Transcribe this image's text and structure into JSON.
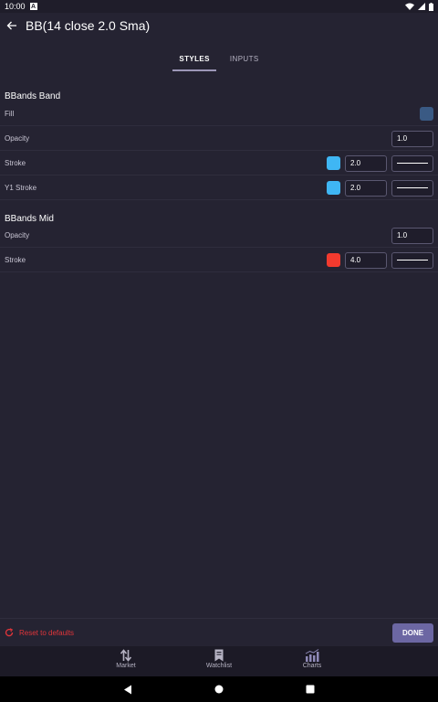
{
  "status_bar": {
    "time": "10:00",
    "notification_icon": "A"
  },
  "header": {
    "title": "BB(14 close 2.0 Sma)"
  },
  "tabs": [
    {
      "label": "STYLES",
      "active": true
    },
    {
      "label": "INPUTS",
      "active": false
    }
  ],
  "sections": [
    {
      "title": "BBands Band",
      "rows": [
        {
          "label": "Fill",
          "color": "#3a5a84"
        },
        {
          "label": "Opacity",
          "value": "1.0"
        },
        {
          "label": "Stroke",
          "color": "#3fb6f4",
          "value": "2.0"
        },
        {
          "label": "Y1 Stroke",
          "color": "#3fb6f4",
          "value": "2.0"
        }
      ]
    },
    {
      "title": "BBands Mid",
      "rows": [
        {
          "label": "Opacity",
          "value": "1.0"
        },
        {
          "label": "Stroke",
          "color": "#f23a2e",
          "value": "4.0"
        }
      ]
    }
  ],
  "footer": {
    "reset_label": "Reset to defaults",
    "done_label": "DONE"
  },
  "bottom_nav": [
    {
      "label": "Market",
      "icon": "arrows-updown-icon"
    },
    {
      "label": "Watchlist",
      "icon": "bookmark-icon"
    },
    {
      "label": "Charts",
      "icon": "chart-bars-icon"
    }
  ],
  "colors": {
    "background": "#252332",
    "accent": "#6c67a3",
    "reset": "#e0353a"
  }
}
